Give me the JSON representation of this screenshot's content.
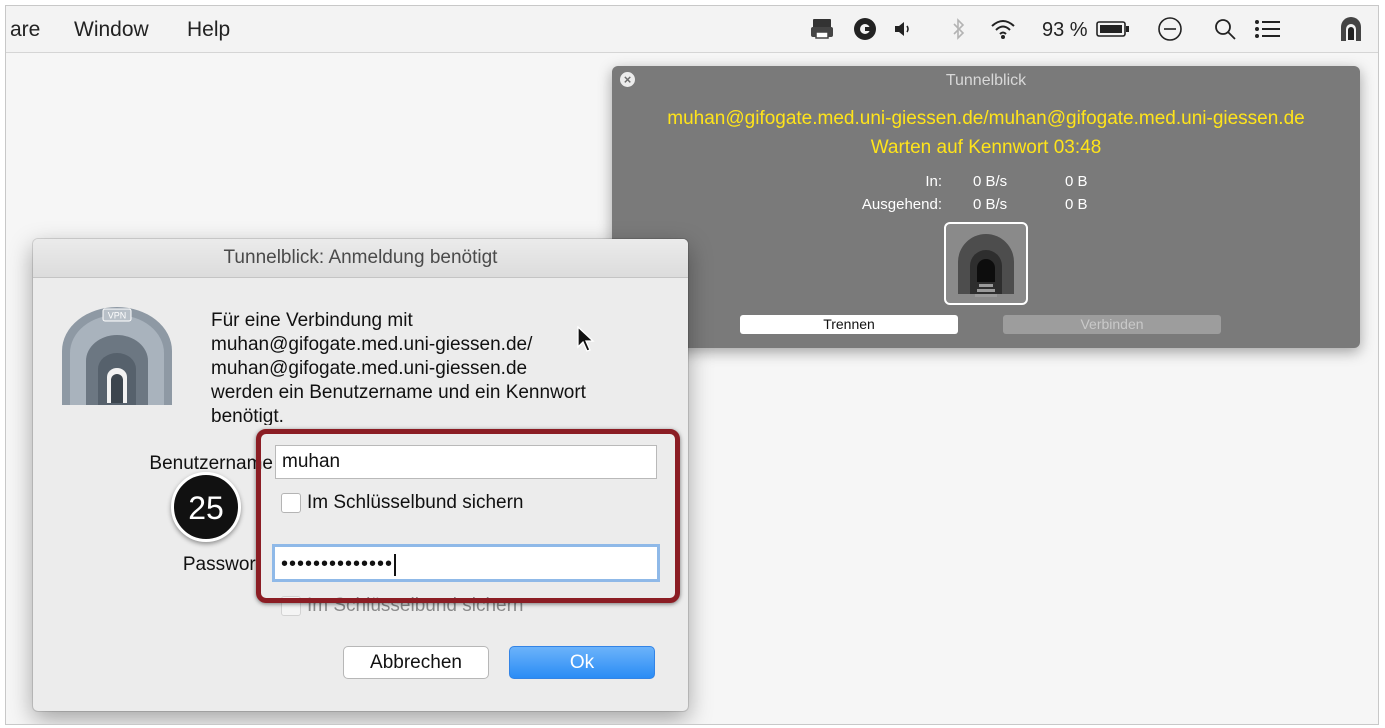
{
  "menubar": {
    "items": [
      "are",
      "Window",
      "Help"
    ],
    "battery_text": "93 %",
    "status_icons": [
      "printer-icon",
      "ring-icon",
      "volume-icon",
      "bluetooth-icon",
      "wifi-icon",
      "battery-icon",
      "do-not-disturb-icon",
      "search-icon",
      "list-icon",
      "tunnelblick-icon"
    ]
  },
  "status_window": {
    "title": "Tunnelblick",
    "connection": "muhan@gifogate.med.uni-giessen.de/muhan@gifogate.med.uni-giessen.de",
    "state": "Warten auf Kennwort 03:48",
    "in_label": "In:",
    "in_rate": "0 B/s",
    "in_total": "0 B",
    "out_label": "Ausgehend:",
    "out_rate": "0 B/s",
    "out_total": "0 B",
    "disconnect_label": "Trennen",
    "connect_label": "Verbinden"
  },
  "dialog": {
    "title": "Tunnelblick: Anmeldung benötigt",
    "icon_label": "VPN",
    "message_lines": [
      "Für eine Verbindung mit",
      " muhan@gifogate.med.uni-giessen.de/",
      "muhan@gifogate.med.uni-giessen.de",
      "werden ein Benutzername und ein Kennwort",
      "benötigt."
    ],
    "username_label": "Benutzername",
    "username_value": "muhan",
    "save_username_label": "Im Schlüsselbund sichern",
    "password_label": "Passwort",
    "password_value": "••••••••••••••",
    "save_password_label": "Im Schlüsselbund sichern",
    "cancel_label": "Abbrechen",
    "ok_label": "Ok"
  },
  "annotation": {
    "step_number": "25",
    "highlight_color": "#8b1d24"
  },
  "colors": {
    "status_text": "#ffe41a",
    "ok_button": "#2a8cf5",
    "focus_ring": "#8fb9e8"
  }
}
